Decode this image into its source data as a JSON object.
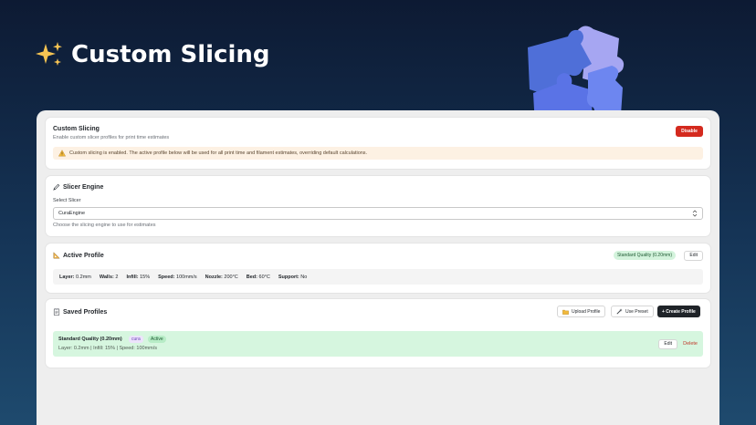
{
  "hero": {
    "title": "Custom Slicing",
    "icon": "sparkles-icon",
    "illustration": "puzzle-pieces-icon"
  },
  "custom_slicing": {
    "title": "Custom Slicing",
    "subtitle": "Enable custom slicer profiles for print time estimates",
    "disable_label": "Disable",
    "warning_text": "Custom slicing is enabled. The active profile below will be used for all print time and filament estimates, overriding default calculations."
  },
  "slicer_engine": {
    "title": "Slicer Engine",
    "select_label": "Select Slicer",
    "selected_value": "CuraEngine",
    "help_text": "Choose the slicing engine to use for estimates"
  },
  "active_profile": {
    "title": "Active Profile",
    "badge": "Standard Quality (0.20mm)",
    "edit_label": "Edit",
    "stats": [
      {
        "label": "Layer:",
        "value": "0.2mm"
      },
      {
        "label": "Walls:",
        "value": "2"
      },
      {
        "label": "Infill:",
        "value": "15%"
      },
      {
        "label": "Speed:",
        "value": "100mm/s"
      },
      {
        "label": "Nozzle:",
        "value": "200°C"
      },
      {
        "label": "Bed:",
        "value": "60°C"
      },
      {
        "label": "Support:",
        "value": "No"
      }
    ]
  },
  "saved_profiles": {
    "title": "Saved Profiles",
    "upload_label": "Upload Profile",
    "preset_label": "Use Preset",
    "create_label": "+ Create Profile",
    "profiles": [
      {
        "name": "Standard Quality (0.20mm)",
        "engine_tag": "cura",
        "status_tag": "Active",
        "details": "Layer: 0.2mm | Infill: 15% | Speed: 100mm/s",
        "edit_label": "Edit",
        "delete_label": "Delete"
      }
    ]
  },
  "colors": {
    "danger": "#d42a1e",
    "active_row": "#d6f6df",
    "warning_bg": "#fdf1e3",
    "primary_dark": "#1f2328"
  }
}
